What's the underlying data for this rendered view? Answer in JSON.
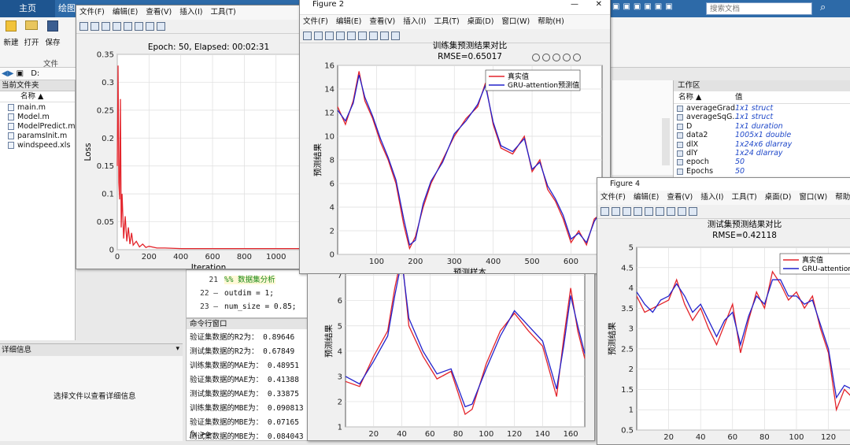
{
  "ribbon": {
    "tabs": [
      "主页",
      "绘图"
    ],
    "buttons": [
      {
        "label": "新建"
      },
      {
        "label": "打开"
      },
      {
        "label": "保存"
      }
    ],
    "section_label": "文件",
    "path_prefix": "D:",
    "search_placeholder": "搜索文档"
  },
  "file_browser": {
    "title": "当前文件夹",
    "column_header": "名称 ▲",
    "files": [
      "main.m",
      "Model.m",
      "ModelPredict.m",
      "paramsInit.m",
      "windspeed.xls"
    ]
  },
  "details": {
    "title": "详细信息",
    "hint": "选择文件以查看详细信息"
  },
  "editor": {
    "lines": [
      {
        "num": "21",
        "text": "%%  数据集分析"
      },
      {
        "num": "22 —",
        "text": "outdim = 1;"
      },
      {
        "num": "23 —",
        "text": "num_size = 0.85;"
      }
    ]
  },
  "command_window": {
    "title": "命令行窗口",
    "lines": [
      "验证集数据的R2为： 0.89646",
      "测试集数据的R2为： 0.67849",
      "训练集数据的MAE为： 0.48951",
      "验证集数据的MAE为： 0.41388",
      "测试集数据的MAE为： 0.33875",
      "训练集数据的MBE为： 0.090813",
      "验证集数据的MBE为： 0.07165",
      "测试集数据的MBE为： 0.084043"
    ],
    "prompt": "fx >>"
  },
  "workspace": {
    "title": "工作区",
    "columns": [
      "名称 ▲",
      "值"
    ],
    "vars": [
      {
        "name": "averageGrad",
        "value": "1x1 struct"
      },
      {
        "name": "averageSqG...",
        "value": "1x1 struct"
      },
      {
        "name": "D",
        "value": "1x1 duration"
      },
      {
        "name": "data2",
        "value": "1005x1 double"
      },
      {
        "name": "dlX",
        "value": "1x24x6 dlarray"
      },
      {
        "name": "dlY",
        "value": "1x24 dlarray"
      },
      {
        "name": "epoch",
        "value": "50"
      },
      {
        "name": "Epochs",
        "value": "50"
      }
    ]
  },
  "figure_menu": [
    "文件(F)",
    "编辑(E)",
    "查看(V)",
    "插入(I)",
    "工具(T)",
    "桌面(D)",
    "窗口(W)",
    "帮助(H)"
  ],
  "figure2": {
    "window_title": "Figure 2"
  },
  "figure4": {
    "window_title": "Figure 4"
  },
  "colors": {
    "true_series": "#e3242b",
    "pred_series": "#2222cc",
    "loss_series": "#e3242b"
  },
  "chart_data": [
    {
      "id": "loss",
      "type": "line",
      "title": "Epoch: 50, Elapsed: 00:02:31",
      "xlabel": "Iteration",
      "ylabel": "Loss",
      "xlim": [
        0,
        1150
      ],
      "ylim": [
        0,
        0.35
      ],
      "xticks": [
        0,
        200,
        400,
        600,
        800,
        1000
      ],
      "yticks": [
        0,
        0.05,
        0.1,
        0.15,
        0.2,
        0.25,
        0.3,
        0.35
      ],
      "grid": true,
      "x": [
        0,
        5,
        10,
        15,
        20,
        25,
        30,
        40,
        50,
        60,
        70,
        80,
        90,
        100,
        120,
        140,
        160,
        180,
        200,
        250,
        300,
        400,
        600,
        800,
        1000,
        1150
      ],
      "y": [
        0.15,
        0.33,
        0.12,
        0.09,
        0.27,
        0.04,
        0.1,
        0.02,
        0.06,
        0.015,
        0.04,
        0.01,
        0.03,
        0.008,
        0.015,
        0.005,
        0.01,
        0.004,
        0.006,
        0.003,
        0.003,
        0.002,
        0.002,
        0.002,
        0.002,
        0.002
      ]
    },
    {
      "id": "train",
      "type": "line",
      "title": "训练集预测结果对比",
      "subtitle": "RMSE=0.65017",
      "xlabel": "预测样本",
      "ylabel": "预测结果",
      "xlim": [
        0,
        680
      ],
      "ylim": [
        0,
        16
      ],
      "xticks": [
        100,
        200,
        300,
        400,
        500,
        600
      ],
      "yticks": [
        0,
        2,
        4,
        6,
        8,
        10,
        12,
        14,
        16
      ],
      "grid": true,
      "legend_position": "top-right",
      "series": [
        {
          "name": "真实值",
          "x": [
            0,
            20,
            40,
            55,
            70,
            90,
            110,
            130,
            150,
            170,
            185,
            200,
            220,
            240,
            270,
            300,
            330,
            360,
            380,
            400,
            420,
            450,
            480,
            500,
            520,
            540,
            560,
            580,
            600,
            620,
            640,
            660,
            680
          ],
          "values": [
            12.5,
            11,
            13,
            15.5,
            13,
            11.5,
            9.5,
            8,
            6,
            2.5,
            0.5,
            1.5,
            4,
            6,
            8,
            10,
            11.5,
            12.5,
            14.5,
            11,
            9,
            8.5,
            10,
            7,
            8,
            5.5,
            4.5,
            3,
            1,
            2,
            0.8,
            3,
            3.5
          ]
        },
        {
          "name": "GRU-attention预测值",
          "x": [
            0,
            20,
            40,
            55,
            70,
            90,
            110,
            130,
            150,
            170,
            185,
            200,
            220,
            240,
            270,
            300,
            330,
            360,
            380,
            400,
            420,
            450,
            480,
            500,
            520,
            540,
            560,
            580,
            600,
            620,
            640,
            660,
            680
          ],
          "values": [
            12.2,
            11.3,
            12.8,
            15.2,
            13.3,
            11.7,
            9.8,
            8.2,
            6.3,
            3,
            0.8,
            1.2,
            4.3,
            6.2,
            7.8,
            10.2,
            11.3,
            12.7,
            14.3,
            11.2,
            9.2,
            8.7,
            9.8,
            7.2,
            7.8,
            5.8,
            4.7,
            3.3,
            1.3,
            1.8,
            1,
            2.8,
            3.8
          ]
        }
      ]
    },
    {
      "id": "valid",
      "type": "line",
      "ylabel": "预测结果",
      "xlim": [
        0,
        170
      ],
      "ylim": [
        1,
        7.8
      ],
      "xticks": [
        20,
        40,
        60,
        80,
        100,
        120,
        140,
        160
      ],
      "yticks": [
        1,
        2,
        3,
        4,
        5,
        6,
        7
      ],
      "grid": true,
      "series": [
        {
          "name": "真实值",
          "x": [
            0,
            10,
            20,
            30,
            35,
            40,
            45,
            55,
            65,
            75,
            85,
            90,
            100,
            110,
            120,
            130,
            140,
            150,
            155,
            160,
            165,
            170
          ],
          "values": [
            2.8,
            2.6,
            3.8,
            4.8,
            6.5,
            7.8,
            5,
            3.8,
            2.9,
            3.2,
            1.5,
            1.7,
            3.5,
            4.8,
            5.5,
            4.8,
            4.2,
            2.2,
            4.5,
            6.5,
            4.8,
            3.7
          ]
        },
        {
          "name": "GRU-attention预测值",
          "x": [
            0,
            10,
            20,
            30,
            35,
            40,
            45,
            55,
            65,
            75,
            85,
            90,
            100,
            110,
            120,
            130,
            140,
            150,
            155,
            160,
            165,
            170
          ],
          "values": [
            3,
            2.7,
            3.6,
            4.6,
            6.2,
            7.6,
            5.3,
            4,
            3.1,
            3.3,
            1.8,
            1.9,
            3.3,
            4.6,
            5.6,
            5,
            4.4,
            2.5,
            4.2,
            6.2,
            5,
            3.9
          ]
        }
      ]
    },
    {
      "id": "test",
      "type": "line",
      "title": "测试集预测结果对比",
      "subtitle": "RMSE=0.42118",
      "ylabel": "预测结果",
      "xlim": [
        0,
        135
      ],
      "ylim": [
        0.5,
        5
      ],
      "xticks": [
        20,
        40,
        60,
        80,
        100,
        120
      ],
      "yticks": [
        0.5,
        1,
        1.5,
        2,
        2.5,
        3,
        3.5,
        4,
        4.5,
        5
      ],
      "grid": true,
      "legend_position": "top-right",
      "series": [
        {
          "name": "真实值",
          "x": [
            0,
            5,
            10,
            15,
            20,
            25,
            30,
            35,
            40,
            45,
            50,
            55,
            60,
            65,
            70,
            75,
            80,
            85,
            90,
            95,
            100,
            105,
            110,
            115,
            120,
            125,
            130,
            135
          ],
          "values": [
            3.8,
            3.4,
            3.5,
            3.6,
            3.7,
            4.2,
            3.6,
            3.2,
            3.5,
            3.0,
            2.6,
            3.1,
            3.6,
            2.4,
            3.2,
            3.9,
            3.5,
            4.4,
            4.1,
            3.7,
            3.9,
            3.5,
            3.8,
            3.0,
            2.4,
            1.0,
            1.5,
            1.3
          ]
        },
        {
          "name": "GRU-attention预测值",
          "x": [
            0,
            5,
            10,
            15,
            20,
            25,
            30,
            35,
            40,
            45,
            50,
            55,
            60,
            65,
            70,
            75,
            80,
            85,
            90,
            95,
            100,
            105,
            110,
            115,
            120,
            125,
            130,
            135
          ],
          "values": [
            3.9,
            3.6,
            3.4,
            3.7,
            3.8,
            4.1,
            3.8,
            3.4,
            3.6,
            3.2,
            2.8,
            3.2,
            3.4,
            2.6,
            3.3,
            3.8,
            3.6,
            4.2,
            4.2,
            3.8,
            3.8,
            3.6,
            3.7,
            3.1,
            2.5,
            1.3,
            1.6,
            1.5
          ]
        }
      ]
    }
  ]
}
